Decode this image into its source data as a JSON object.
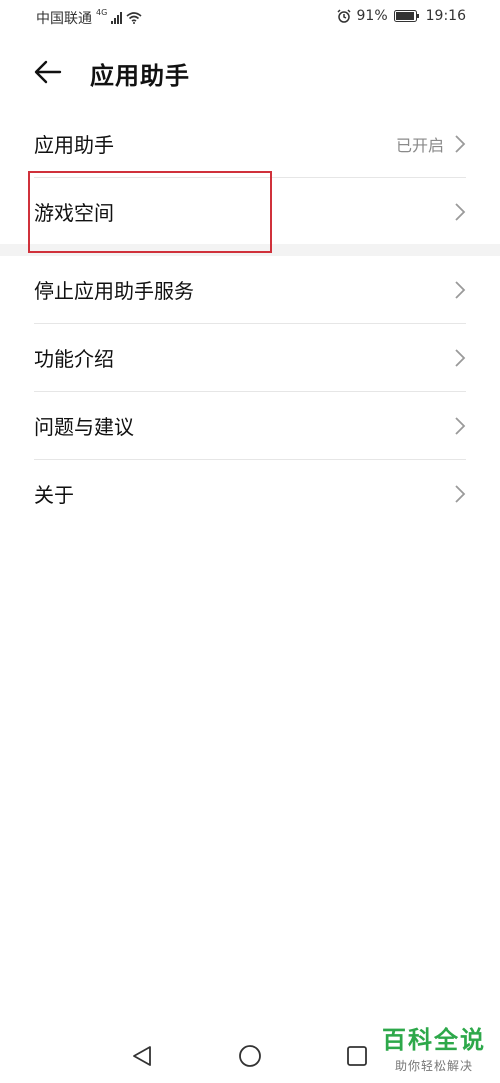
{
  "status_bar": {
    "carrier": "中国联通",
    "network_tag": "4G",
    "battery_percent": "91%",
    "time": "19:16"
  },
  "header": {
    "title": "应用助手"
  },
  "list_group_1": [
    {
      "label": "应用助手",
      "status": "已开启"
    },
    {
      "label": "游戏空间",
      "status": ""
    }
  ],
  "list_group_2": [
    {
      "label": "停止应用助手服务"
    },
    {
      "label": "功能介绍"
    },
    {
      "label": "问题与建议"
    },
    {
      "label": "关于"
    }
  ],
  "watermark": {
    "title": "百科全说",
    "subtitle": "助你轻松解决"
  },
  "colors": {
    "highlight_border": "#d0313b",
    "watermark_green": "#2da84a"
  }
}
